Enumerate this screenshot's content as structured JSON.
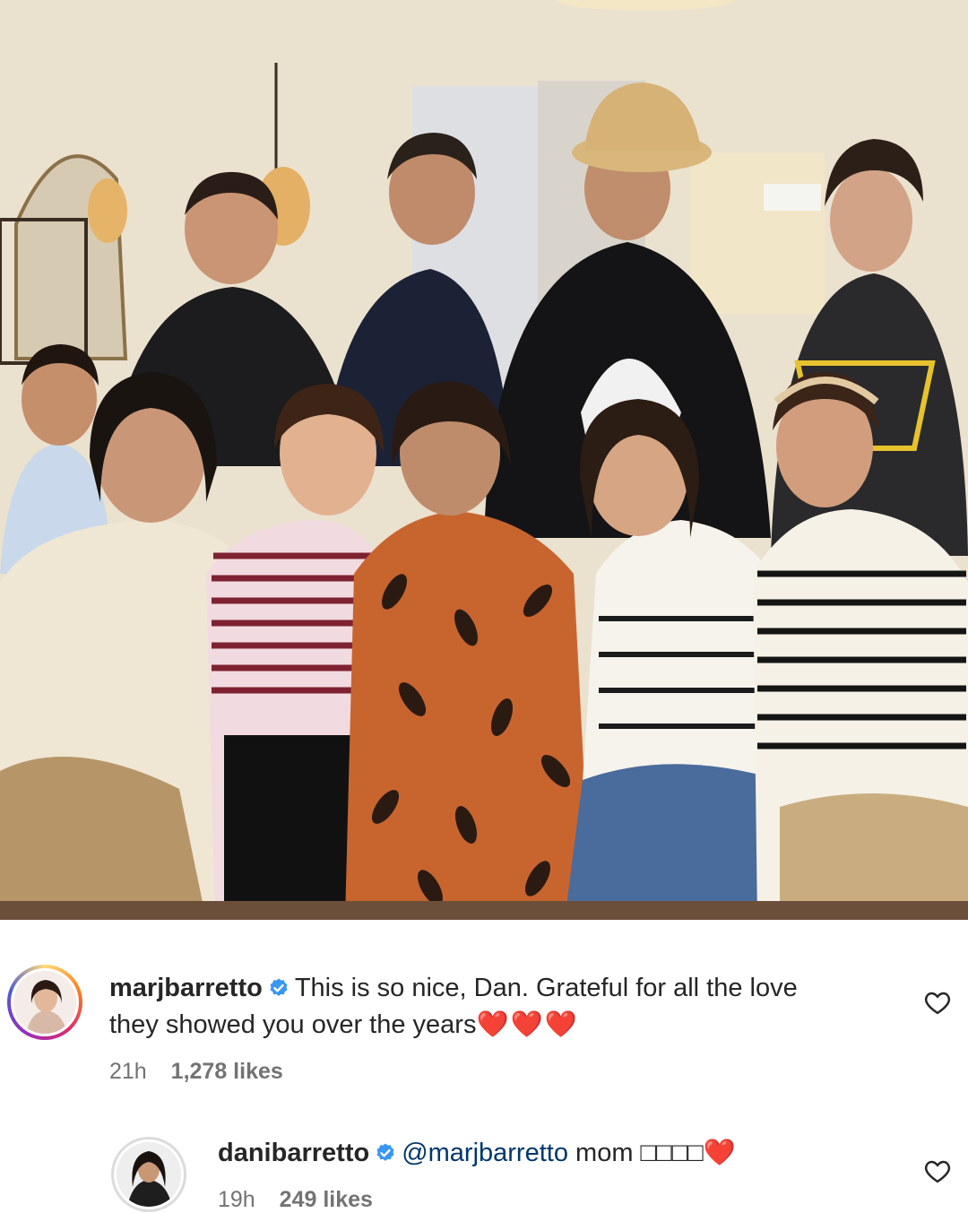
{
  "post": {
    "image_alt": "",
    "comments": [
      {
        "username": "marjbarretto",
        "verified": true,
        "text_line1": "This is so nice, Dan. Grateful for all the love",
        "text_line2": "they showed you over the years",
        "hearts": "❤️❤️❤️",
        "time": "21h",
        "likes": "1,278 likes"
      },
      {
        "username": "danibarretto",
        "verified": true,
        "mention": "@marjbarretto",
        "text": "mom □□□□",
        "hearts": "❤️",
        "time": "19h",
        "likes": "249 likes"
      }
    ]
  },
  "colors": {
    "verified": "#3897f0",
    "mention": "#00376b",
    "meta": "#737373",
    "heart": "#e0142c"
  },
  "icons": {
    "verified": "verified-badge-icon",
    "like": "heart-outline-icon"
  }
}
